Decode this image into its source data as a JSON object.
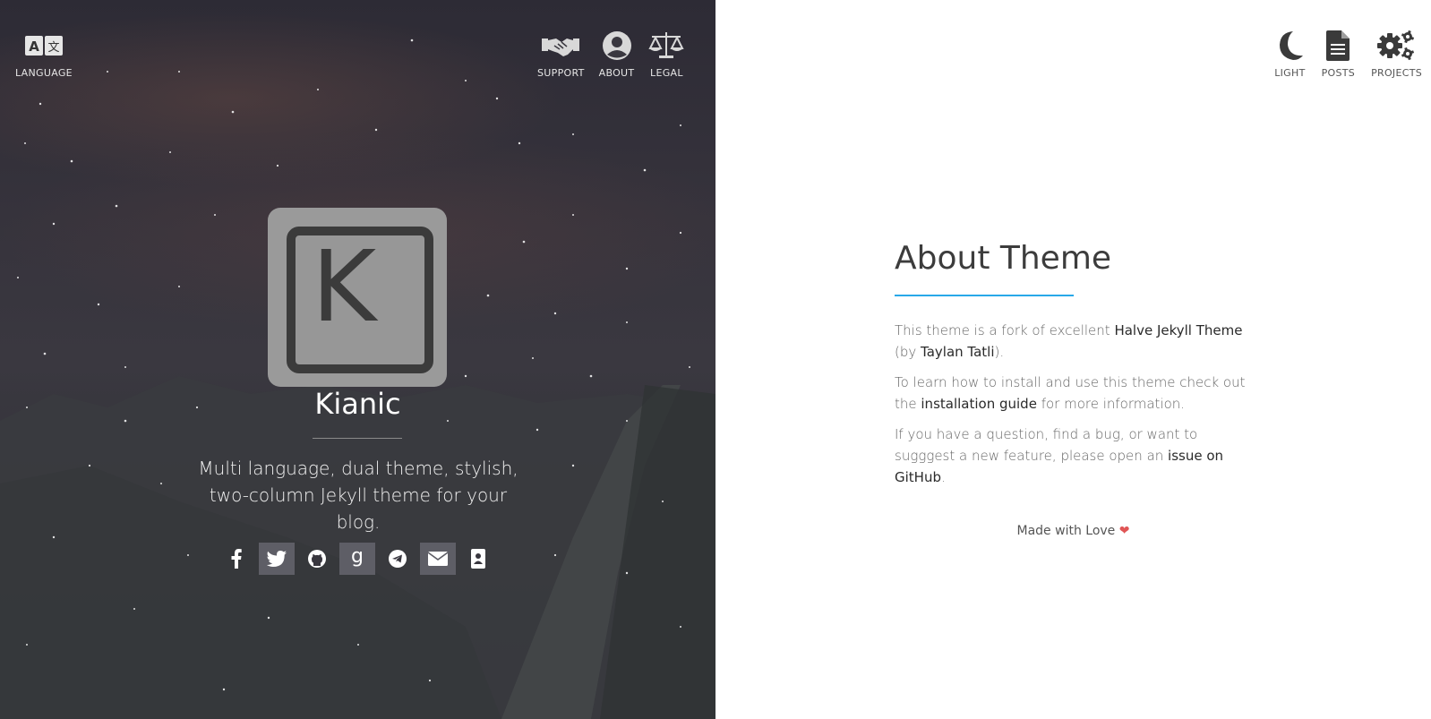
{
  "left": {
    "nav_left": [
      {
        "label": "LANGUAGE",
        "icon": "language-icon"
      }
    ],
    "nav_right": [
      {
        "label": "SUPPORT",
        "icon": "handshake-icon"
      },
      {
        "label": "ABOUT",
        "icon": "user-circle-icon"
      },
      {
        "label": "LEGAL",
        "icon": "balance-scale-icon"
      }
    ],
    "logo_letter": "K",
    "site_title": "Kianic",
    "tagline": "Multi language, dual theme, stylish, two-column Jekyll theme for your blog.",
    "social": [
      {
        "icon": "facebook-icon"
      },
      {
        "icon": "twitter-icon"
      },
      {
        "icon": "github-icon"
      },
      {
        "icon": "goodreads-icon"
      },
      {
        "icon": "telegram-icon"
      },
      {
        "icon": "email-icon"
      },
      {
        "icon": "contact-card-icon"
      }
    ]
  },
  "right": {
    "nav": [
      {
        "label": "LIGHT",
        "icon": "moon-icon"
      },
      {
        "label": "POSTS",
        "icon": "document-icon"
      },
      {
        "label": "PROJECTS",
        "icon": "gears-icon"
      }
    ],
    "about_title": "About Theme",
    "p1_text_a": "This theme is a fork of excellent ",
    "p1_link_a": "Halve Jekyll Theme",
    "p1_text_b": " (by ",
    "p1_link_b": "Taylan Tatli",
    "p1_text_c": ").",
    "p2_text_a": "To learn how to install and use this theme check out the ",
    "p2_link": "installation guide",
    "p2_text_b": " for more information.",
    "p3_text_a": "If you have a question, find a bug, or want to sugggest a new feature, please open an ",
    "p3_link": "issue on GitHub",
    "p3_text_b": ".",
    "footer": "Made with Love",
    "footer_heart": "❤"
  },
  "colors": {
    "accent_rule": "#28a8e8",
    "heart": "#e05555",
    "dark_bg": "#36333c"
  }
}
